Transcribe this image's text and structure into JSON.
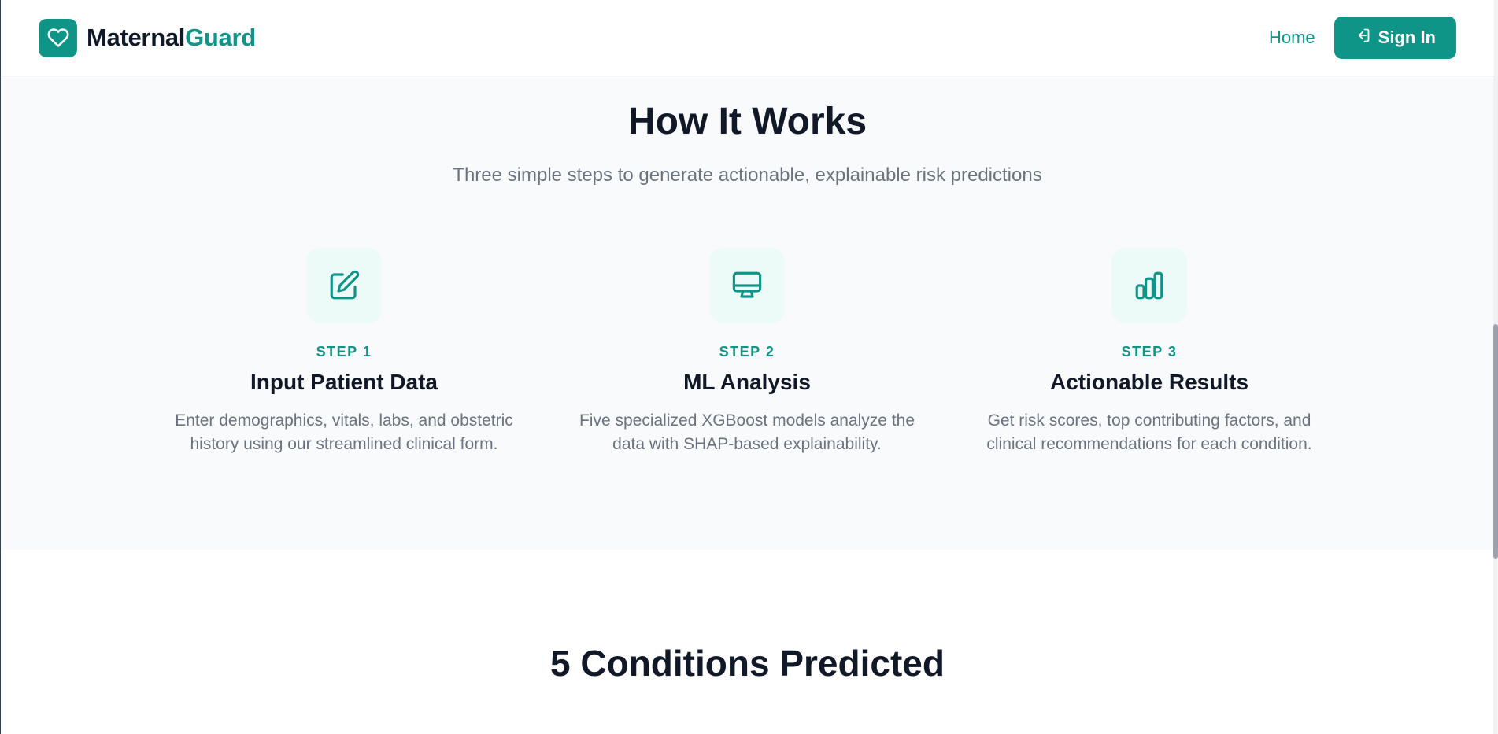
{
  "header": {
    "brand_part1": "Maternal",
    "brand_part2": "Guard",
    "brand_icon": "heart-icon",
    "nav": {
      "home_label": "Home",
      "signin_label": "Sign In",
      "signin_icon": "log-in-icon"
    }
  },
  "how_it_works": {
    "title": "How It Works",
    "subtitle": "Three simple steps to generate actionable, explainable risk predictions",
    "steps": [
      {
        "icon": "edit-icon",
        "label": "STEP 1",
        "title": "Input Patient Data",
        "description": "Enter demographics, vitals, labs, and obstetric history using our streamlined clinical form."
      },
      {
        "icon": "monitor-icon",
        "label": "STEP 2",
        "title": "ML Analysis",
        "description": "Five specialized XGBoost models analyze the data with SHAP-based explainability."
      },
      {
        "icon": "bar-chart-icon",
        "label": "STEP 3",
        "title": "Actionable Results",
        "description": "Get risk scores, top contributing factors, and clinical recommendations for each condition."
      }
    ]
  },
  "conditions": {
    "title": "5 Conditions Predicted"
  },
  "colors": {
    "accent": "#0f9488",
    "section_bg": "#f8fafb",
    "icon_bg": "#ecfbf8",
    "text_primary": "#111827",
    "text_muted": "#6b7280"
  }
}
